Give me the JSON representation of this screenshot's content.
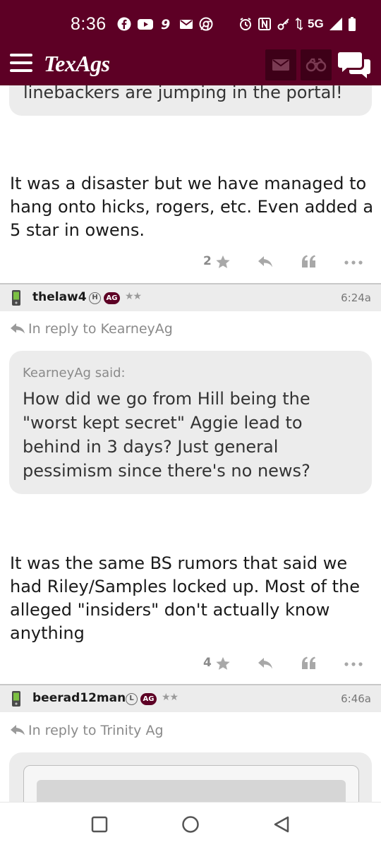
{
  "status_bar": {
    "time": "8:36",
    "network": "5G",
    "icons_left": [
      "facebook-icon",
      "youtube-icon",
      "game-icon",
      "gmail-icon",
      "chrome-icon"
    ],
    "icons_right": [
      "alarm-icon",
      "nfc-icon",
      "key-icon",
      "data-arrows-icon",
      "signal-icon",
      "battery-icon"
    ]
  },
  "header": {
    "logo": "TexAgs",
    "brand_color": "#5d0025",
    "buttons": [
      "menu-icon",
      "mail-icon",
      "binoculars-icon",
      "chat-icon"
    ]
  },
  "posts": [
    {
      "quoted_partial": "linebackers are jumping in the portal!",
      "body": "It was a disaster but we have managed to hang onto hicks, rogers, etc. Even added a 5 star in owens.",
      "stars": "2"
    },
    {
      "username": "thelaw4",
      "badge": "H",
      "ag_badge": "AG",
      "rank_stars": "★★",
      "time": "6:24a",
      "reply_to": "In reply to KearneyAg",
      "quote_author": "KearneyAg said:",
      "quote_text": "How did we go from Hill being the \"worst kept secret\" Aggie lead to behind in 3 days? Just general pessimism since there's no news?",
      "body": "It was the same BS rumors that said we had Riley/Samples locked up. Most of the alleged \"insiders\" don't actually know anything",
      "stars": "4"
    },
    {
      "username": "beerad12man",
      "badge": "L",
      "ag_badge": "AG",
      "rank_stars": "★★",
      "time": "6:46a",
      "reply_to": "In reply to Trinity Ag"
    }
  ],
  "nav_bar": [
    "recents-icon",
    "home-icon",
    "back-icon"
  ]
}
